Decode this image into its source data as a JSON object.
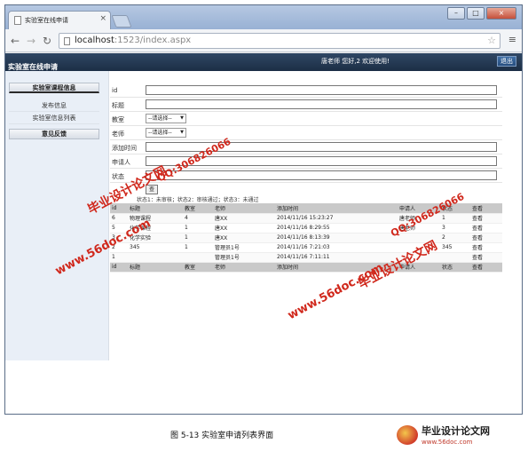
{
  "browser": {
    "tab_title": "实验室在线申请",
    "url_host": "localhost",
    "url_path": ":1523/index.aspx"
  },
  "header": {
    "app_title": "实验室在线申请",
    "welcome": "唐老师 您好,2 欢迎使用!",
    "logout_label": "退出"
  },
  "sidebar": {
    "section1": "实验室课程信息",
    "items": [
      "发布信息",
      "实验室信息列表"
    ],
    "section2": "意见反馈"
  },
  "form": {
    "fields": [
      {
        "label": "id",
        "type": "input",
        "value": ""
      },
      {
        "label": "标题",
        "type": "input",
        "value": ""
      },
      {
        "label": "教室",
        "type": "select",
        "value": "--请选择--"
      },
      {
        "label": "老师",
        "type": "select",
        "value": "--请选择--"
      },
      {
        "label": "添加时间",
        "type": "input",
        "value": ""
      },
      {
        "label": "申请人",
        "type": "input",
        "value": ""
      },
      {
        "label": "状态",
        "type": "input",
        "value": ""
      }
    ],
    "search_label": "查",
    "status_note": "状态1：未审核；状态2：审核通过；状态3：未通过"
  },
  "table": {
    "columns": [
      "id",
      "标题",
      "教室",
      "老师",
      "添加时间",
      "申请人",
      "状态",
      "查看"
    ],
    "rows": [
      [
        "6",
        "物理课程",
        "4",
        "唐XX",
        "2014/11/16 15:23:27",
        "唐老师",
        "1",
        "查看"
      ],
      [
        "5",
        "化学课程",
        "1",
        "唐XX",
        "2014/11/16 8:29:55",
        "唐老师",
        "3",
        "查看"
      ],
      [
        "3",
        "化学实验",
        "1",
        "唐XX",
        "2014/11/16 8:13:39",
        "",
        "2",
        "查看"
      ],
      [
        "2",
        "345",
        "1",
        "管理员1号",
        "2014/11/16 7:21:03",
        "",
        "345",
        "查看"
      ],
      [
        "1",
        "",
        "",
        "管理员1号",
        "2014/11/16 7:11:11",
        "",
        "",
        "查看"
      ]
    ]
  },
  "caption": "图 5-13  实验室申请列表界面",
  "logo": {
    "title": "毕业设计论文网",
    "url": "www.56doc.com"
  },
  "watermarks": [
    "毕业设计论文网",
    "QQ:306826066",
    "www.56doc.com",
    "毕业设计论文网",
    "QQ:306826066",
    "www.56doc.com"
  ]
}
